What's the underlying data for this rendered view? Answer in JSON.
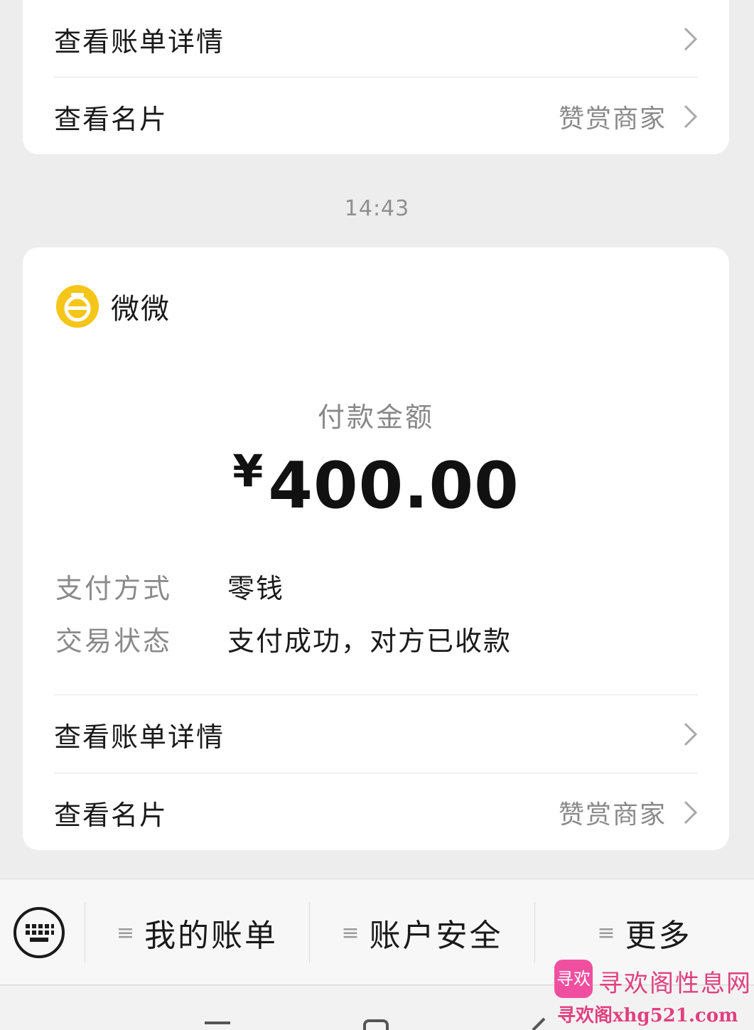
{
  "top_card": {
    "bill_details_label": "查看账单详情",
    "business_card_label": "查看名片",
    "tip_merchant_label": "赞赏商家"
  },
  "timestamp": "14:43",
  "payment_card": {
    "merchant_name": "微微",
    "amount_label": "付款金额",
    "currency_symbol": "¥",
    "amount": "400.00",
    "payment_method_key": "支付方式",
    "payment_method_value": "零钱",
    "status_key": "交易状态",
    "status_value": "支付成功，对方已收款",
    "bill_details_label": "查看账单详情",
    "business_card_label": "查看名片",
    "tip_merchant_label": "赞赏商家"
  },
  "bottom_menu": {
    "keyboard_icon": "keyboard-icon",
    "items": [
      {
        "icon": "menu-lines-icon",
        "label": "我的账单"
      },
      {
        "icon": "menu-lines-icon",
        "label": "账户安全"
      },
      {
        "icon": "menu-lines-icon",
        "label": "更多"
      }
    ]
  },
  "watermark": {
    "title": "寻欢阁性息网",
    "url": "寻欢阁xhg521.com",
    "logo_text": "寻欢"
  },
  "colors": {
    "background": "#ededed",
    "card": "#ffffff",
    "merchant_logo": "#f5c518",
    "watermark": "#e0407f"
  }
}
